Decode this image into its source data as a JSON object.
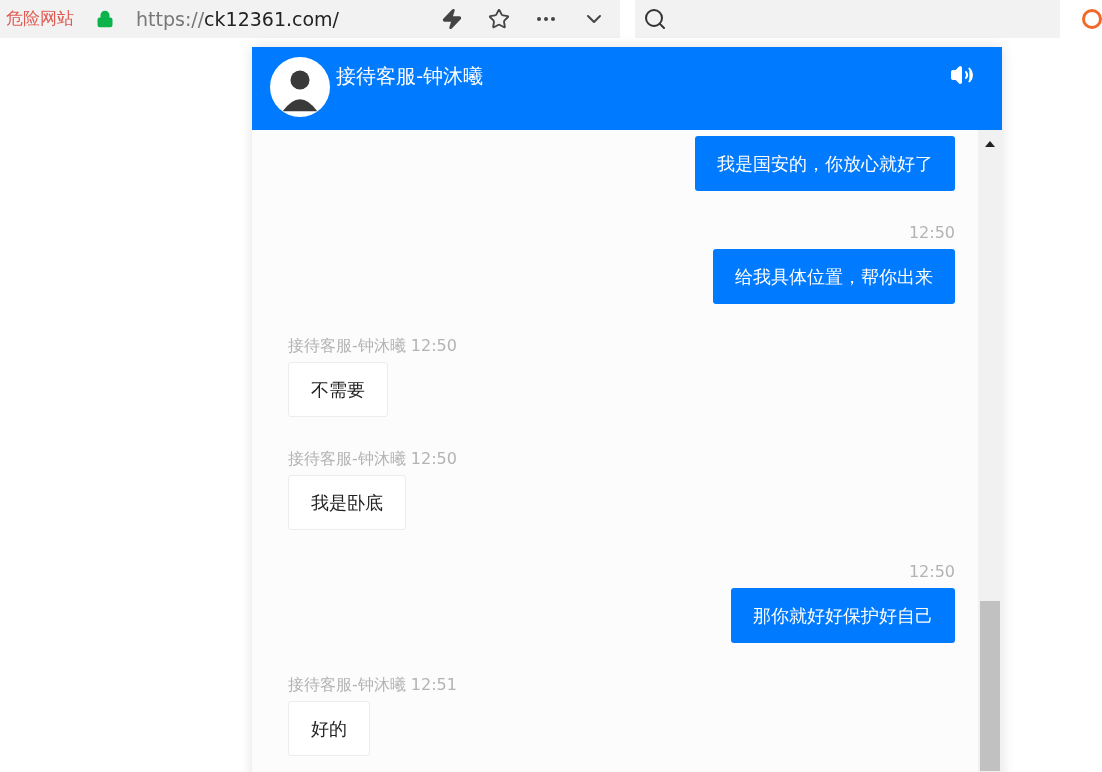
{
  "browser": {
    "warning": "危险网站",
    "url_scheme": "https://",
    "url_host": "ck12361.com/"
  },
  "chat": {
    "title": "接待客服-钟沐曦",
    "messages": [
      {
        "kind": "sent",
        "text": "我是国安的，你放心就好了"
      },
      {
        "kind": "sent",
        "meta": "12:50",
        "text": "给我具体位置，帮你出来"
      },
      {
        "kind": "received",
        "meta": "接待客服-钟沐曦 12:50",
        "text": "不需要"
      },
      {
        "kind": "received",
        "meta": "接待客服-钟沐曦 12:50",
        "text": "我是卧底"
      },
      {
        "kind": "sent",
        "meta": "12:50",
        "text": "那你就好好保护好自己"
      },
      {
        "kind": "received",
        "meta": "接待客服-钟沐曦 12:51",
        "text": "好的"
      }
    ]
  }
}
